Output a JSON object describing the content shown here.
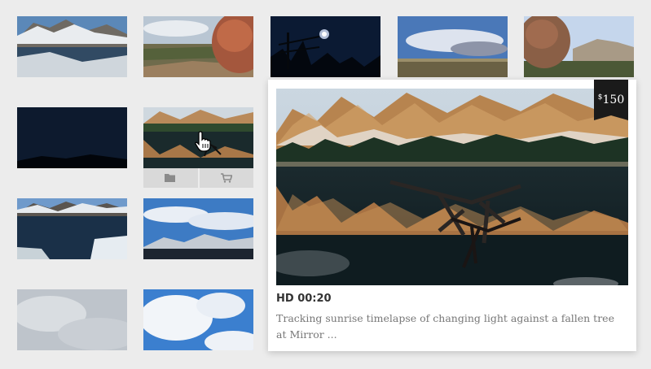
{
  "preview": {
    "price_symbol": "$",
    "price_value": "150",
    "meta": "HD 00:20",
    "description": "Tracking sunrise timelapse of changing light against a fallen tree at Mirror ..."
  },
  "actions": {
    "folder_icon": "folder-icon",
    "cart_icon": "cart-icon"
  },
  "colors": {
    "background": "#ececec",
    "price_tag": "#1a1a1a",
    "action_bar": "#d9d9d9"
  }
}
